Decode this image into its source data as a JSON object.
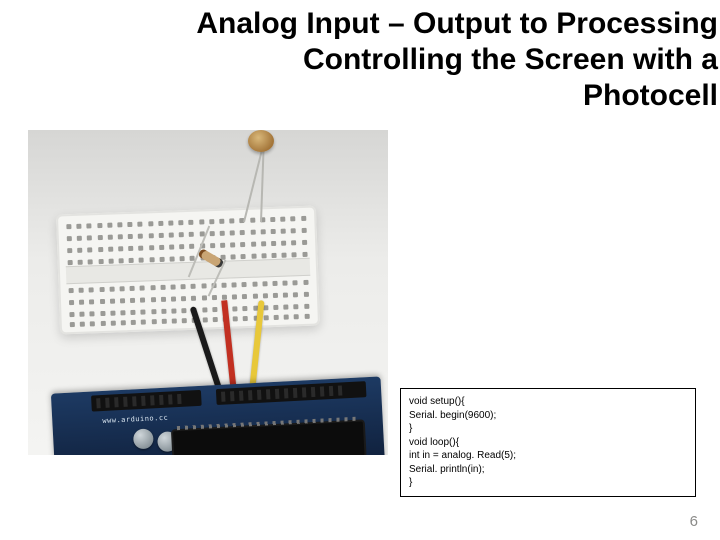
{
  "title": {
    "line1": "Analog Input – Output to Processing",
    "line2": "Controlling the Screen with a",
    "line3": "Photocell"
  },
  "board_label": "www.arduino.cc",
  "code": {
    "l1": "void setup(){",
    "l2": "Serial. begin(9600);",
    "l3": "}",
    "l4": "void loop(){",
    "l5": "int in = analog. Read(5);",
    "l6": "Serial. println(in);",
    "l7": "}"
  },
  "page_number": "6"
}
